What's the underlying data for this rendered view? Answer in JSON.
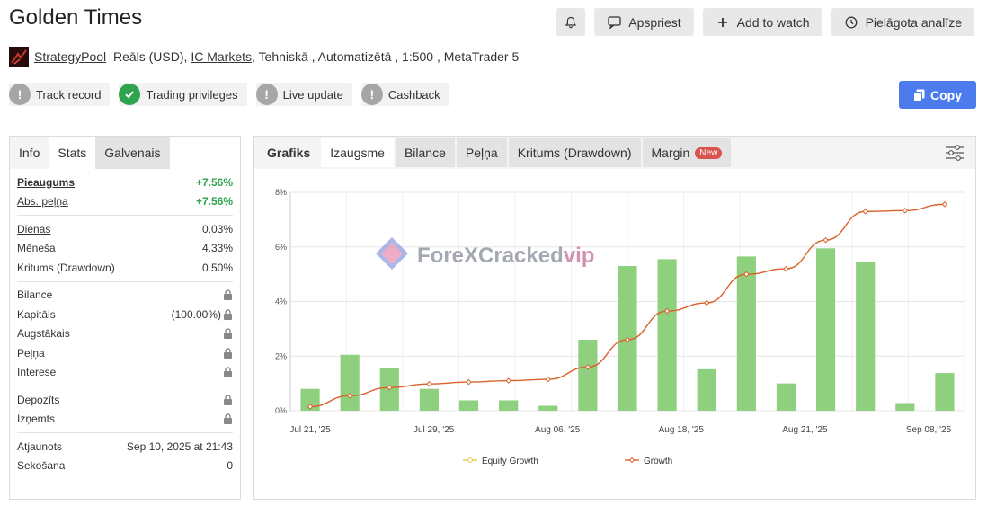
{
  "header": {
    "title": "Golden Times",
    "actions": {
      "discuss_label": "Apspriest",
      "watch_label": "Add to watch",
      "analysis_label": "Pielāgota analīze"
    },
    "meta": {
      "provider": "StrategyPool",
      "account": "Reāls (USD),",
      "broker": "IC Markets",
      "details": ", Tehniskā , Automatizētā , 1:500 , MetaTrader 5"
    },
    "badges": {
      "track_record": "Track record",
      "trading_privileges": "Trading privileges",
      "live_update": "Live update",
      "cashback": "Cashback"
    },
    "copy_label": "Copy"
  },
  "left_panel": {
    "tabs": {
      "info": "Info",
      "stats": "Stats",
      "main": "Galvenais"
    },
    "stats": {
      "gain_label": "Pieaugums",
      "gain_value": "+7.56%",
      "abs_profit_label": "Abs. peļņa",
      "abs_profit_value": "+7.56%",
      "daily_label": "Dienas",
      "daily_value": "0.03%",
      "monthly_label": "Mēneša",
      "monthly_value": "4.33%",
      "drawdown_label": "Kritums (Drawdown)",
      "drawdown_value": "0.50%",
      "balance_label": "Bilance",
      "equity_label": "Kapitāls",
      "equity_value": "(100.00%)",
      "highest_label": "Augstākais",
      "profit_label": "Peļņa",
      "interest_label": "Interese",
      "deposits_label": "Depozīts",
      "withdrawals_label": "Izņemts",
      "updated_label": "Atjaunots",
      "updated_value": "Sep 10, 2025 at 21:43",
      "following_label": "Sekošana",
      "following_value": "0"
    }
  },
  "right_panel": {
    "tabs": {
      "chart": "Grafiks",
      "growth": "Izaugsme",
      "balance": "Bilance",
      "profit": "Peļņa",
      "drawdown": "Kritums (Drawdown)",
      "margin": "Margin",
      "new_badge": "New"
    },
    "settings_icon": "sliders-icon"
  },
  "watermark": {
    "main": "ForeXCracked",
    "suffix": "vip"
  },
  "colors": {
    "bar": "#8fd07f",
    "line": "#d9622b",
    "accent": "#4b7bec",
    "green": "#2ea44f"
  },
  "chart_data": {
    "type": "bar",
    "y_ticks": [
      "0%",
      "2%",
      "4%",
      "6%",
      "8%"
    ],
    "ylim": [
      0,
      8
    ],
    "x_ticks": [
      "Jul 21, '25",
      "Jul 29, '25",
      "Aug 06, '25",
      "Aug 18, '25",
      "Aug 21, '25",
      "Sep 08, '25"
    ],
    "bars": [
      0.8,
      2.05,
      1.58,
      0.8,
      0.38,
      0.38,
      0.18,
      2.6,
      5.3,
      5.55,
      1.52,
      5.65,
      1.0,
      5.95,
      5.45,
      0.28,
      1.38
    ],
    "growth_line": [
      0.15,
      0.55,
      0.85,
      0.98,
      1.05,
      1.1,
      1.15,
      1.6,
      2.6,
      3.65,
      3.95,
      5.0,
      5.2,
      6.25,
      7.3,
      7.33,
      7.56
    ],
    "legend": [
      "Equity Growth",
      "Growth"
    ],
    "grid": true,
    "legend_position": "bottom"
  }
}
